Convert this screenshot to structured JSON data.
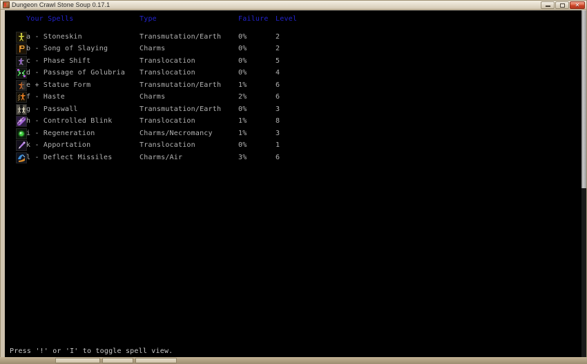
{
  "window": {
    "title": "Dungeon Crawl Stone Soup 0.17.1",
    "app_icon": "crawl-icon",
    "minimize_label": "",
    "maximize_label": "",
    "close_label": "✕"
  },
  "table": {
    "headers": {
      "spells": "Your Spells",
      "type": "Type",
      "failure": "Failure",
      "level": "Level"
    },
    "header_color": "#2323cf",
    "text_color": "#b3b3b3",
    "rows": [
      {
        "icon": "stoneskin-icon",
        "name": "a - Stoneskin",
        "type": "Transmutation/Earth",
        "failure": "0%",
        "level": "2"
      },
      {
        "icon": "song-of-slaying-icon",
        "name": "b - Song of Slaying",
        "type": "Charms",
        "failure": "0%",
        "level": "2"
      },
      {
        "icon": "phase-shift-icon",
        "name": "c - Phase Shift",
        "type": "Translocation",
        "failure": "0%",
        "level": "5"
      },
      {
        "icon": "passage-of-golubria-icon",
        "name": "d - Passage of Golubria",
        "type": "Translocation",
        "failure": "0%",
        "level": "4"
      },
      {
        "icon": "statue-form-icon",
        "name": "e + Statue Form",
        "type": "Transmutation/Earth",
        "failure": "1%",
        "level": "6"
      },
      {
        "icon": "haste-icon",
        "name": "f - Haste",
        "type": "Charms",
        "failure": "2%",
        "level": "6"
      },
      {
        "icon": "passwall-icon",
        "name": "g - Passwall",
        "type": "Transmutation/Earth",
        "failure": "0%",
        "level": "3"
      },
      {
        "icon": "controlled-blink-icon",
        "name": "h - Controlled Blink",
        "type": "Translocation",
        "failure": "1%",
        "level": "8"
      },
      {
        "icon": "regeneration-icon",
        "name": "i - Regeneration",
        "type": "Charms/Necromancy",
        "failure": "1%",
        "level": "3"
      },
      {
        "icon": "apportation-icon",
        "name": "k - Apportation",
        "type": "Translocation",
        "failure": "0%",
        "level": "1"
      },
      {
        "icon": "deflect-missiles-icon",
        "name": "l - Deflect Missiles",
        "type": "Charms/Air",
        "failure": "3%",
        "level": "6"
      }
    ]
  },
  "status": {
    "message": "Press '!' or 'I' to toggle spell view."
  }
}
